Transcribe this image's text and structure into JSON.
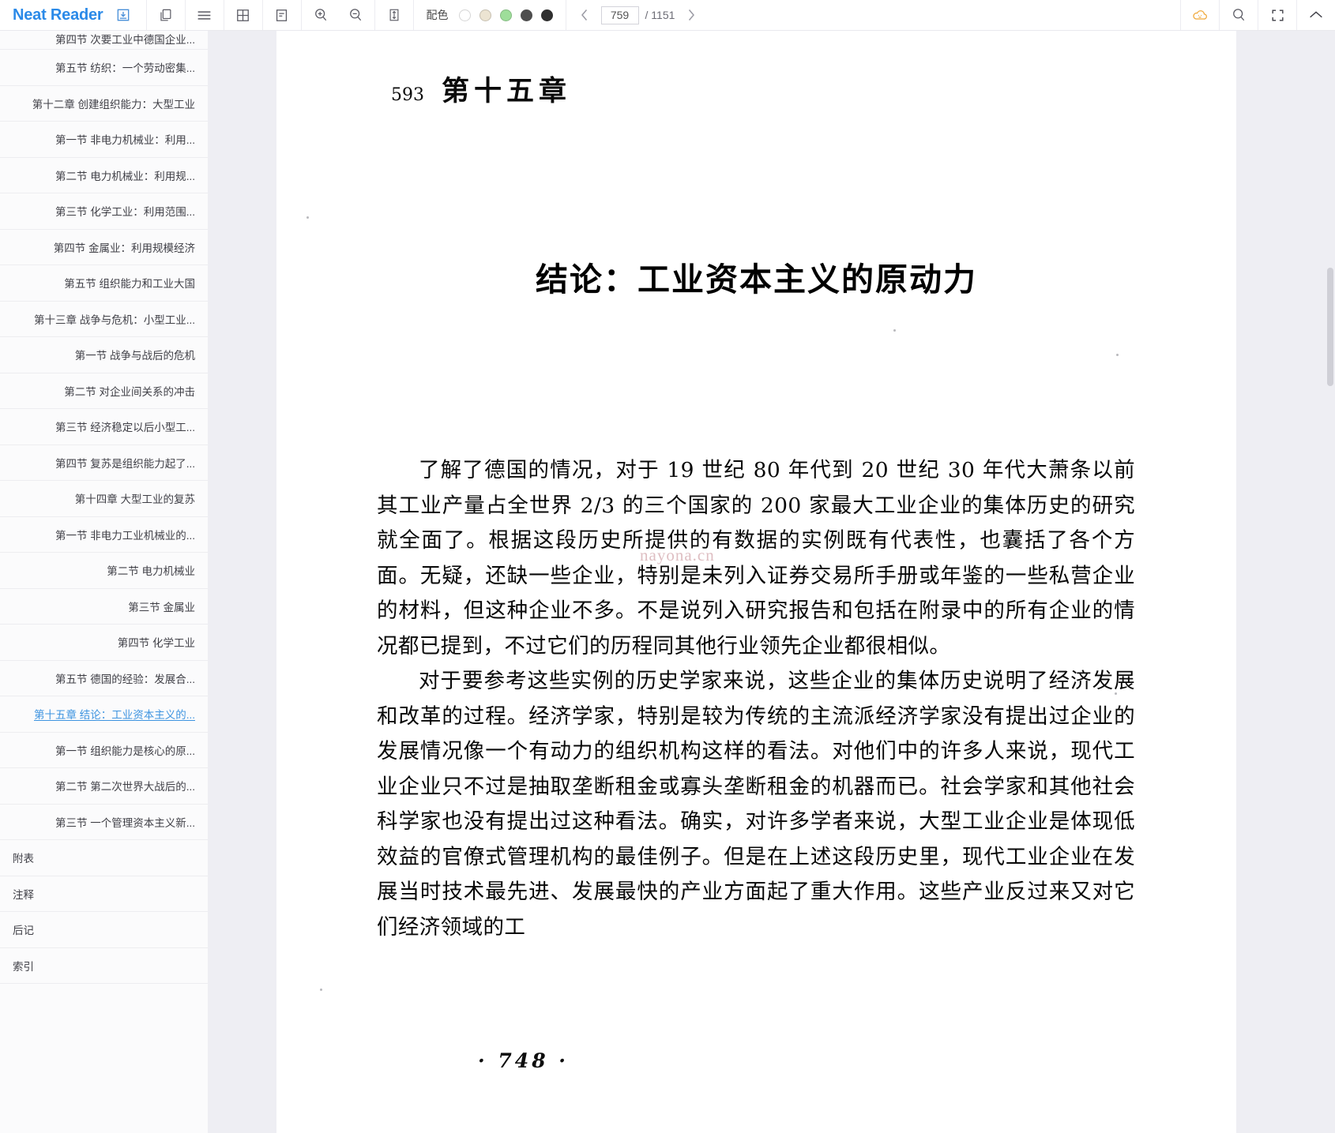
{
  "app": {
    "name": "Neat Reader",
    "accent_color": "#2b8ae8"
  },
  "toolbar": {
    "icons": [
      {
        "name": "download-book-icon",
        "glyph": "download"
      },
      {
        "name": "copy-icon",
        "glyph": "copy"
      },
      {
        "name": "list-view-icon",
        "glyph": "list"
      },
      {
        "name": "grid-view-icon",
        "glyph": "grid"
      },
      {
        "name": "page-layout-icon",
        "glyph": "page"
      },
      {
        "name": "zoom-in-icon",
        "glyph": "zoom-in"
      },
      {
        "name": "zoom-out-icon",
        "glyph": "zoom-out"
      },
      {
        "name": "fit-height-icon",
        "glyph": "fit-height"
      }
    ],
    "color_scheme": {
      "label": "配色",
      "swatches": [
        "#ffffff",
        "#ece4d2",
        "#9ede9a",
        "#4e4e4e",
        "#2f2f2f"
      ],
      "selected_index": 0
    },
    "pager": {
      "prev_label": "‹",
      "next_label": "›",
      "current_page": "759",
      "separator": "/ 1151",
      "total_pages": "1151"
    },
    "right_icons": [
      {
        "name": "cloud-sync-icon",
        "glyph": "cloud",
        "color": "#f0a93c"
      },
      {
        "name": "search-icon",
        "glyph": "search"
      },
      {
        "name": "fullscreen-icon",
        "glyph": "fullscreen"
      },
      {
        "name": "collapse-toolbar-icon",
        "glyph": "chevron-up"
      }
    ]
  },
  "sidebar": {
    "items": [
      {
        "label": "第四节 次要工业中德国企业...",
        "level": 2,
        "active": false,
        "clipped": true
      },
      {
        "label": "第五节 纺织：一个劳动密集...",
        "level": 2,
        "active": false
      },
      {
        "label": "第十二章 创建组织能力：大型工业",
        "level": 1,
        "active": false
      },
      {
        "label": "第一节 非电力机械业：利用...",
        "level": 2,
        "active": false
      },
      {
        "label": "第二节 电力机械业：利用规...",
        "level": 2,
        "active": false
      },
      {
        "label": "第三节 化学工业：利用范围...",
        "level": 2,
        "active": false
      },
      {
        "label": "第四节 金属业：利用规模经济",
        "level": 2,
        "active": false
      },
      {
        "label": "第五节 组织能力和工业大国",
        "level": 2,
        "active": false
      },
      {
        "label": "第十三章 战争与危机：小型工业...",
        "level": 1,
        "active": false
      },
      {
        "label": "第一节 战争与战后的危机",
        "level": 2,
        "active": false
      },
      {
        "label": "第二节 对企业间关系的冲击",
        "level": 2,
        "active": false
      },
      {
        "label": "第三节 经济稳定以后小型工...",
        "level": 2,
        "active": false
      },
      {
        "label": "第四节 复苏是组织能力起了...",
        "level": 2,
        "active": false
      },
      {
        "label": "第十四章 大型工业的复苏",
        "level": 1,
        "active": false
      },
      {
        "label": "第一节 非电力工业机械业的...",
        "level": 2,
        "active": false
      },
      {
        "label": "第二节 电力机械业",
        "level": 2,
        "active": false
      },
      {
        "label": "第三节 金属业",
        "level": 2,
        "active": false
      },
      {
        "label": "第四节 化学工业",
        "level": 2,
        "active": false
      },
      {
        "label": "第五节 德国的经验：发展合...",
        "level": 2,
        "active": false
      },
      {
        "label": "第十五章 结论：工业资本主义的...",
        "level": 1,
        "active": true
      },
      {
        "label": "第一节 组织能力是核心的原...",
        "level": 2,
        "active": false
      },
      {
        "label": "第二节 第二次世界大战后的...",
        "level": 2,
        "active": false
      },
      {
        "label": "第三节 一个管理资本主义新...",
        "level": 2,
        "active": false
      },
      {
        "label": "附表",
        "level": 0,
        "active": false
      },
      {
        "label": "注释",
        "level": 0,
        "active": false
      },
      {
        "label": "后记",
        "level": 0,
        "active": false
      },
      {
        "label": "索引",
        "level": 0,
        "active": false
      }
    ]
  },
  "page_content": {
    "chapter_number": "593",
    "chapter_label": "第十五章",
    "title": "结论：工业资本主义的原动力",
    "paragraphs": [
      "了解了德国的情况，对于 19 世纪 80 年代到 20 世纪 30 年代大萧条以前其工业产量占全世界 2/3 的三个国家的 200 家最大工业企业的集体历史的研究就全面了。根据这段历史所提供的有数据的实例既有代表性，也囊括了各个方面。无疑，还缺一些企业，特别是未列入证券交易所手册或年鉴的一些私营企业的材料，但这种企业不多。不是说列入研究报告和包括在附录中的所有企业的情况都已提到，不过它们的历程同其他行业领先企业都很相似。",
      "对于要参考这些实例的历史学家来说，这些企业的集体历史说明了经济发展和改革的过程。经济学家，特别是较为传统的主流派经济学家没有提出过企业的发展情况像一个有动力的组织机构这样的看法。对他们中的许多人来说，现代工业企业只不过是抽取垄断租金或寡头垄断租金的机器而已。社会学家和其他社会科学家也没有提出过这种看法。确实，对许多学者来说，大型工业企业是体现低效益的官僚式管理机构的最佳例子。但是在上述这段历史里，现代工业企业在发展当时技术最先进、发展最快的产业方面起了重大作用。这些产业反过来又对它们经济领域的工"
    ],
    "watermark": "nayona.cn",
    "footer": "· 748 ·"
  }
}
